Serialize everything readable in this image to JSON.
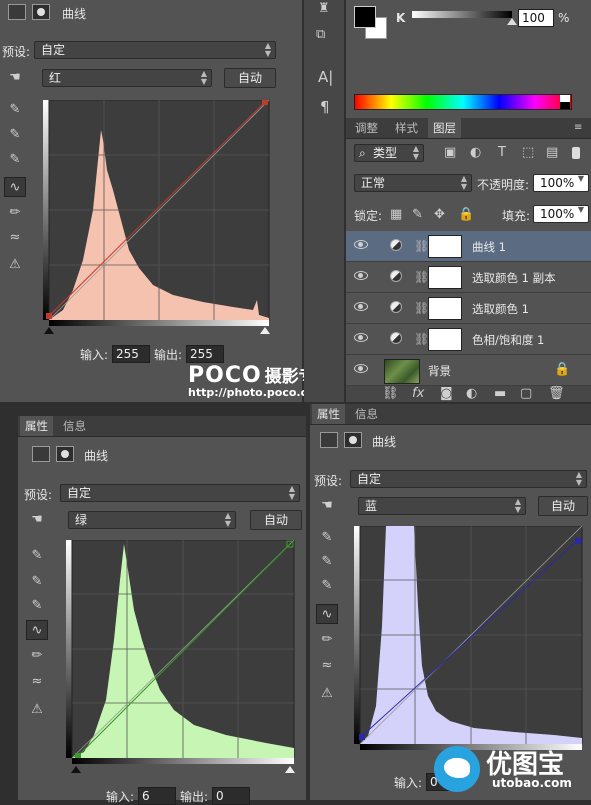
{
  "top_left": {
    "panel_title": "曲线",
    "preset_label": "预设:",
    "preset_value": "自定",
    "channel_value": "红",
    "auto_label": "自动",
    "input_label": "输入:",
    "input_value": "255",
    "output_label": "输出:",
    "output_value": "255",
    "histogram_color": "#f6c2b0",
    "curve_color": "#c23a2a"
  },
  "color_panel": {
    "channel_label": "K",
    "slider_value": "100",
    "unit": "%"
  },
  "layers_panel": {
    "tabs": [
      "调整",
      "样式",
      "图层"
    ],
    "filter_label": "类型",
    "blend_mode": "正常",
    "opacity_label": "不透明度:",
    "opacity_value": "100%",
    "lock_label": "锁定:",
    "fill_label": "填充:",
    "fill_value": "100%",
    "layers": [
      {
        "name": "曲线 1"
      },
      {
        "name": "选取颜色 1 副本"
      },
      {
        "name": "选取颜色 1"
      },
      {
        "name": "色相/饱和度 1"
      },
      {
        "name": "背景"
      }
    ]
  },
  "watermark": {
    "brand": "POCO",
    "brand_suffix": "摄影专题",
    "url": "http://photo.poco.cn/"
  },
  "bottom_left": {
    "tabs": [
      "属性",
      "信息"
    ],
    "panel_title": "曲线",
    "preset_label": "预设:",
    "preset_value": "自定",
    "channel_value": "绿",
    "auto_label": "自动",
    "input_label": "输入:",
    "input_value": "6",
    "output_label": "输出:",
    "output_value": "0",
    "histogram_color": "#c6f5b4",
    "curve_color": "#3a9a2a"
  },
  "bottom_right": {
    "tabs": [
      "属性",
      "信息"
    ],
    "panel_title": "曲线",
    "preset_label": "预设:",
    "preset_value": "自定",
    "channel_value": "蓝",
    "auto_label": "自动",
    "input_label": "输入:",
    "input_value": "0",
    "histogram_color": "#d4d2fb",
    "curve_color": "#2a2aa8"
  },
  "site_watermark": {
    "name": "优图宝",
    "url": "utobao.com"
  }
}
